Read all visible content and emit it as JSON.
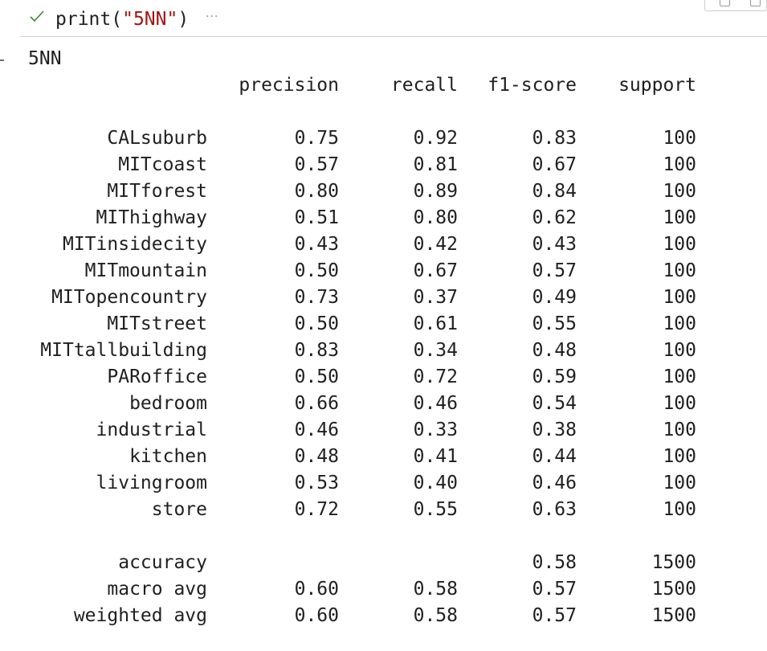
{
  "cell": {
    "code_prefix": "print(",
    "code_string": "\"5NN\"",
    "code_suffix": ")",
    "ellipsis": "···",
    "status_icon": "check-icon"
  },
  "output": {
    "title": "5NN",
    "headers": {
      "precision": "precision",
      "recall": "recall",
      "f1": "f1-score",
      "support": "support"
    },
    "rows": [
      {
        "label": "CALsuburb",
        "precision": "0.75",
        "recall": "0.92",
        "f1": "0.83",
        "support": "100"
      },
      {
        "label": "MITcoast",
        "precision": "0.57",
        "recall": "0.81",
        "f1": "0.67",
        "support": "100"
      },
      {
        "label": "MITforest",
        "precision": "0.80",
        "recall": "0.89",
        "f1": "0.84",
        "support": "100"
      },
      {
        "label": "MIThighway",
        "precision": "0.51",
        "recall": "0.80",
        "f1": "0.62",
        "support": "100"
      },
      {
        "label": "MITinsidecity",
        "precision": "0.43",
        "recall": "0.42",
        "f1": "0.43",
        "support": "100"
      },
      {
        "label": "MITmountain",
        "precision": "0.50",
        "recall": "0.67",
        "f1": "0.57",
        "support": "100"
      },
      {
        "label": "MITopencountry",
        "precision": "0.73",
        "recall": "0.37",
        "f1": "0.49",
        "support": "100"
      },
      {
        "label": "MITstreet",
        "precision": "0.50",
        "recall": "0.61",
        "f1": "0.55",
        "support": "100"
      },
      {
        "label": "MITtallbuilding",
        "precision": "0.83",
        "recall": "0.34",
        "f1": "0.48",
        "support": "100"
      },
      {
        "label": "PARoffice",
        "precision": "0.50",
        "recall": "0.72",
        "f1": "0.59",
        "support": "100"
      },
      {
        "label": "bedroom",
        "precision": "0.66",
        "recall": "0.46",
        "f1": "0.54",
        "support": "100"
      },
      {
        "label": "industrial",
        "precision": "0.46",
        "recall": "0.33",
        "f1": "0.38",
        "support": "100"
      },
      {
        "label": "kitchen",
        "precision": "0.48",
        "recall": "0.41",
        "f1": "0.44",
        "support": "100"
      },
      {
        "label": "livingroom",
        "precision": "0.53",
        "recall": "0.40",
        "f1": "0.46",
        "support": "100"
      },
      {
        "label": "store",
        "precision": "0.72",
        "recall": "0.55",
        "f1": "0.63",
        "support": "100"
      }
    ],
    "summary": [
      {
        "label": "accuracy",
        "precision": "",
        "recall": "",
        "f1": "0.58",
        "support": "1500"
      },
      {
        "label": "macro avg",
        "precision": "0.60",
        "recall": "0.58",
        "f1": "0.57",
        "support": "1500"
      },
      {
        "label": "weighted avg",
        "precision": "0.60",
        "recall": "0.58",
        "f1": "0.57",
        "support": "1500"
      }
    ]
  },
  "colors": {
    "check": "#388a34",
    "string": "#a31515",
    "text": "#1f1f1f",
    "divider": "#d6d6d6"
  }
}
